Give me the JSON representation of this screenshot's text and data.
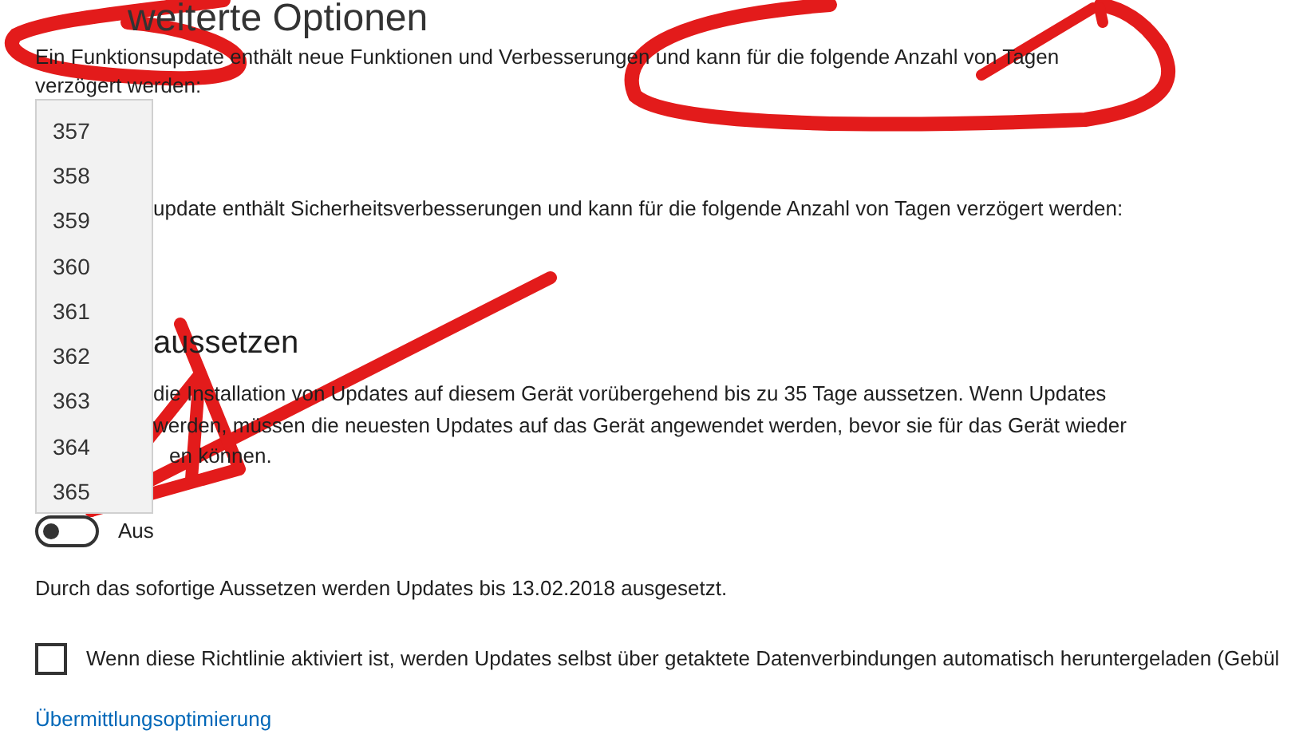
{
  "title": "weiterte Optionen",
  "feature_text": [
    "Ein Funktionsupdate enthält neue Funktionen und Verbesserungen und kann für die folgende Anzahl von Tagen",
    "verzögert werden:"
  ],
  "quality_text": "update enthält Sicherheitsverbesserungen und kann für die folgende Anzahl von Tagen verzögert werden:",
  "pause_heading": "aussetzen",
  "pause_text": [
    "die Installation von Updates auf diesem Gerät vorübergehend bis zu 35 Tage aussetzen. Wenn Updates",
    "werden, müssen die neuesten Updates auf das Gerät angewendet werden, bevor sie für das Gerät wieder",
    "en können."
  ],
  "pause_toggle": {
    "on": false,
    "label": "Aus"
  },
  "pause_info": "Durch das sofortige Aussetzen werden Updates bis 13.02.2018 ausgesetzt.",
  "metered_checkbox": {
    "checked": false,
    "label": "Wenn diese Richtlinie aktiviert ist, werden Updates selbst über getaktete Datenverbindungen automatisch heruntergeladen (Gebül"
  },
  "link": "Übermittlungsoptimierung",
  "dropdown_items": [
    "357",
    "358",
    "359",
    "360",
    "361",
    "362",
    "363",
    "364",
    "365"
  ]
}
